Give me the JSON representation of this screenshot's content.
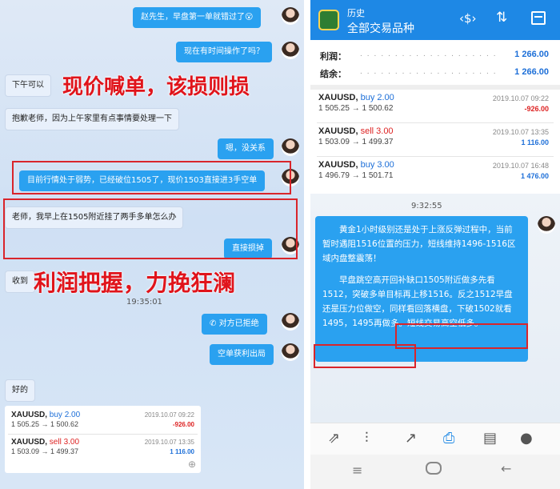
{
  "left_chat": {
    "messages": {
      "m1": "赵先生，早盘第一单就错过了😮",
      "m2": "现在有时间操作了吗？",
      "m3": "下午可以",
      "m4": "抱歉老师，因为上午家里有点事情要处理一下",
      "m5": "嗯，没关系",
      "m6": "目前行情处于弱势，已经破位1505了，现价1503直接进3手空单",
      "m7": "老师，我早上在1505附近挂了两手多单怎么办",
      "m8": "直接损掉",
      "m9": "收到",
      "m10": "对方已拒绝",
      "m11": "空单获利出局",
      "m12": "好的"
    },
    "timestamp": "19:35:01",
    "overlay_top": "现价喊单，该损则损",
    "overlay_bottom": "利润把握，力挽狂澜",
    "trades": [
      {
        "symbol": "XAUUSD,",
        "side": "buy 2.00",
        "prices": "1 505.25 → 1 500.62",
        "datetime": "2019.10.07 09:22",
        "profit": "-926.00"
      },
      {
        "symbol": "XAUUSD,",
        "side": "sell 3.00",
        "prices": "1 503.09 → 1 499.37",
        "datetime": "2019.10.07 13:35",
        "profit": "1 116.00"
      }
    ]
  },
  "right_app": {
    "header": {
      "title": "历史",
      "subtitle": "全部交易品种"
    },
    "summary": [
      {
        "label": "利润：",
        "value": "1 266.00"
      },
      {
        "label": "结余：",
        "value": "1 266.00"
      }
    ],
    "trades": [
      {
        "symbol": "XAUUSD,",
        "side": "buy 2.00",
        "prices": "1 505.25 → 1 500.62",
        "datetime": "2019.10.07 09:22",
        "profit": "-926.00"
      },
      {
        "symbol": "XAUUSD,",
        "side": "sell 3.00",
        "prices": "1 503.09 → 1 499.37",
        "datetime": "2019.10.07 13:35",
        "profit": "1 116.00"
      },
      {
        "symbol": "XAUUSD,",
        "side": "buy 3.00",
        "prices": "1 496.79 → 1 501.71",
        "datetime": "2019.10.07 16:48",
        "profit": "1 476.00"
      }
    ],
    "chat_time": "9:32:55",
    "message_p1": "黄金1小时级别还是处于上涨反弹过程中，当前暂时遇阻1516位置的压力，短线维持1496-1516区域内盘整震荡！",
    "message_p2": "早盘跳空高开回补缺口1505附近做多先看1512，突破多单目标再上移1516。反之1512早盘还是压力位做空，同样看回落横盘，下破1502就看1495，1495再做多。短线交易高空低多。"
  },
  "colors": {
    "accent": "#1e88e5",
    "bubble": "#2aa1f0",
    "alert": "#d9252b",
    "loss": "#dd2222",
    "gain": "#1d6fd8"
  },
  "icons": [
    "emoji-icon",
    "phone-icon",
    "zoom-in-icon",
    "app-logo-icon",
    "currency-sort-icon",
    "sort-icon",
    "calendar-icon",
    "trade-icon",
    "candles-icon",
    "chart-icon",
    "history-inbox-icon",
    "news-icon",
    "chat-icon",
    "nav-menu-icon",
    "nav-home-icon",
    "nav-back-icon"
  ]
}
